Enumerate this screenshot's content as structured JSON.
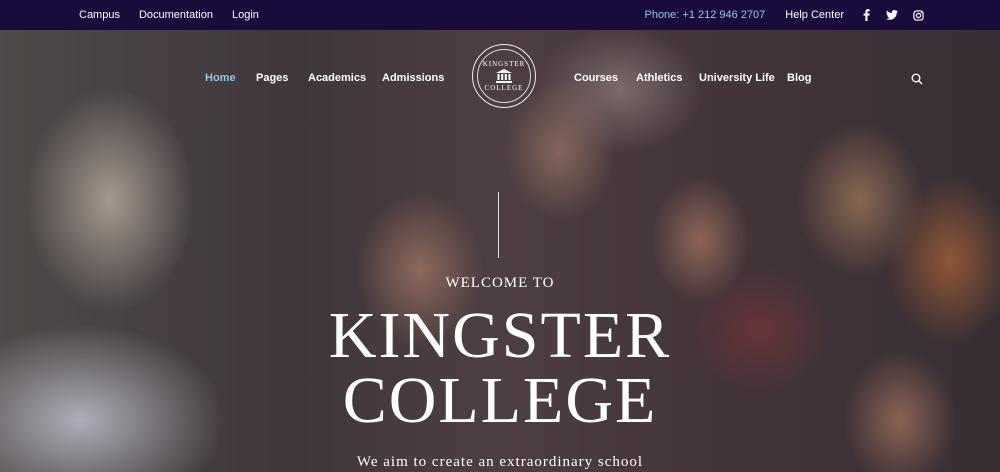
{
  "topbar": {
    "links": [
      "Campus",
      "Documentation",
      "Login"
    ],
    "phone": "Phone: +1 212 946 2707",
    "help": "Help Center",
    "social_icons": [
      "facebook-icon",
      "twitter-icon",
      "instagram-icon"
    ]
  },
  "nav": {
    "left_items": [
      "Home",
      "Pages",
      "Academics",
      "Admissions"
    ],
    "right_items": [
      "Courses",
      "Athletics",
      "University Life",
      "Blog"
    ],
    "active_item": "Home",
    "logo": {
      "word1": "KINGSTER",
      "word2": "COLLEGE"
    }
  },
  "hero": {
    "welcome": "WELCOME TO",
    "title_line1": "KINGSTER",
    "title_line2": "COLLEGE",
    "tagline": "We aim to create an extraordinary school"
  },
  "colors": {
    "topbar_bg": "#1a0b3d",
    "accent": "#8fc9e8",
    "text": "#ffffff"
  }
}
